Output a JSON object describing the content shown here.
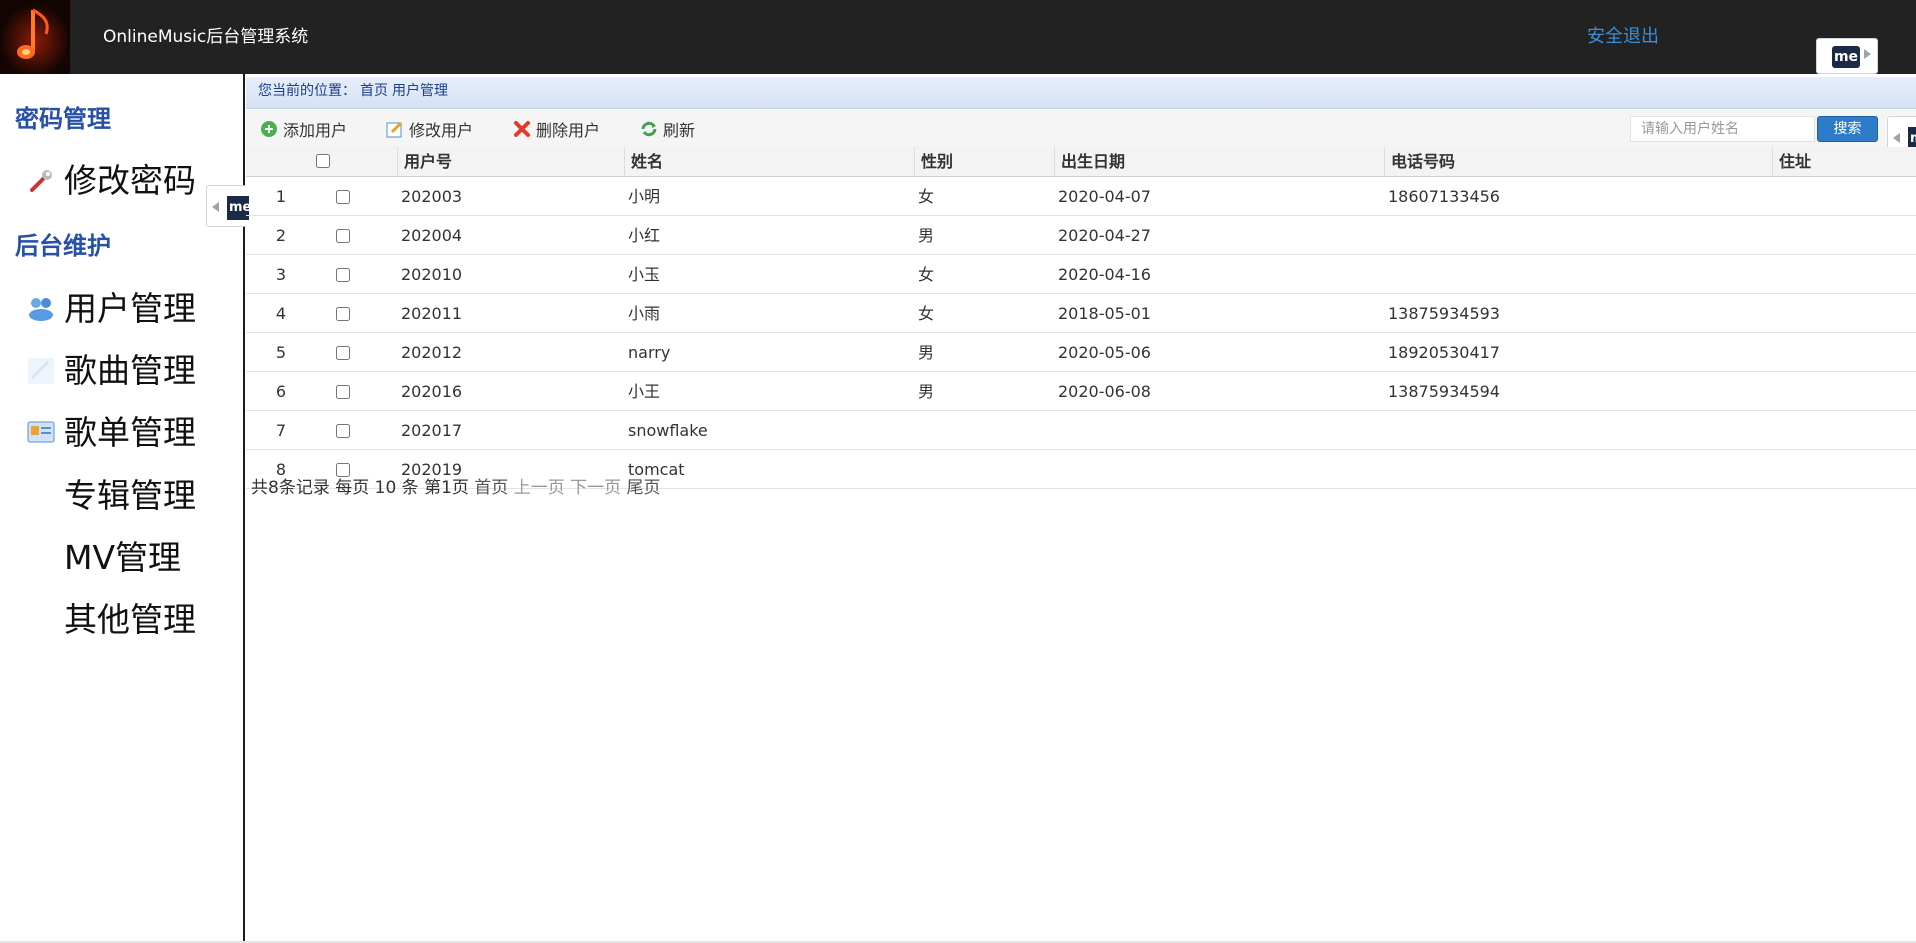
{
  "header": {
    "title": "OnlineMusic后台管理系统",
    "logout": "安全退出",
    "me_badge": "me"
  },
  "sidebar": {
    "sections": [
      {
        "title": "密码管理",
        "items": [
          {
            "label": "修改密码",
            "icon": "wrench-icon"
          }
        ]
      },
      {
        "title": "后台维护",
        "items": [
          {
            "label": "用户管理",
            "icon": "users-icon"
          },
          {
            "label": "歌曲管理",
            "icon": "music-icon"
          },
          {
            "label": "歌单管理",
            "icon": "playlist-icon"
          },
          {
            "label": "专辑管理",
            "icon": ""
          },
          {
            "label": "MV管理",
            "icon": ""
          },
          {
            "label": "其他管理",
            "icon": ""
          }
        ]
      }
    ]
  },
  "breadcrumb": {
    "prefix": "您当前的位置：",
    "home": "首页",
    "current": "用户管理"
  },
  "toolbar": {
    "add": "添加用户",
    "edit": "修改用户",
    "delete": "删除用户",
    "refresh": "刷新",
    "search_placeholder": "请输入用户姓名",
    "search_button": "搜索"
  },
  "table": {
    "columns": [
      "用户号",
      "姓名",
      "性别",
      "出生日期",
      "电话号码",
      "住址"
    ],
    "rows": [
      {
        "n": "1",
        "id": "202003",
        "name": "小明",
        "sex": "女",
        "birth": "2020-04-07",
        "phone": "18607133456",
        "addr": ""
      },
      {
        "n": "2",
        "id": "202004",
        "name": "小红",
        "sex": "男",
        "birth": "2020-04-27",
        "phone": "",
        "addr": ""
      },
      {
        "n": "3",
        "id": "202010",
        "name": "小玉",
        "sex": "女",
        "birth": "2020-04-16",
        "phone": "",
        "addr": ""
      },
      {
        "n": "4",
        "id": "202011",
        "name": "小雨",
        "sex": "女",
        "birth": "2018-05-01",
        "phone": "13875934593",
        "addr": ""
      },
      {
        "n": "5",
        "id": "202012",
        "name": "narry",
        "sex": "男",
        "birth": "2020-05-06",
        "phone": "18920530417",
        "addr": ""
      },
      {
        "n": "6",
        "id": "202016",
        "name": "小王",
        "sex": "男",
        "birth": "2020-06-08",
        "phone": "13875934594",
        "addr": ""
      },
      {
        "n": "7",
        "id": "202017",
        "name": "snowflake",
        "sex": "",
        "birth": "",
        "phone": "",
        "addr": ""
      },
      {
        "n": "8",
        "id": "202019",
        "name": "tomcat",
        "sex": "",
        "birth": "",
        "phone": "",
        "addr": ""
      }
    ]
  },
  "pager": {
    "summary": "共8条记录 每页 10 条 第1页",
    "first": "首页",
    "prev": "上一页",
    "next": "下一页",
    "last": "尾页"
  }
}
